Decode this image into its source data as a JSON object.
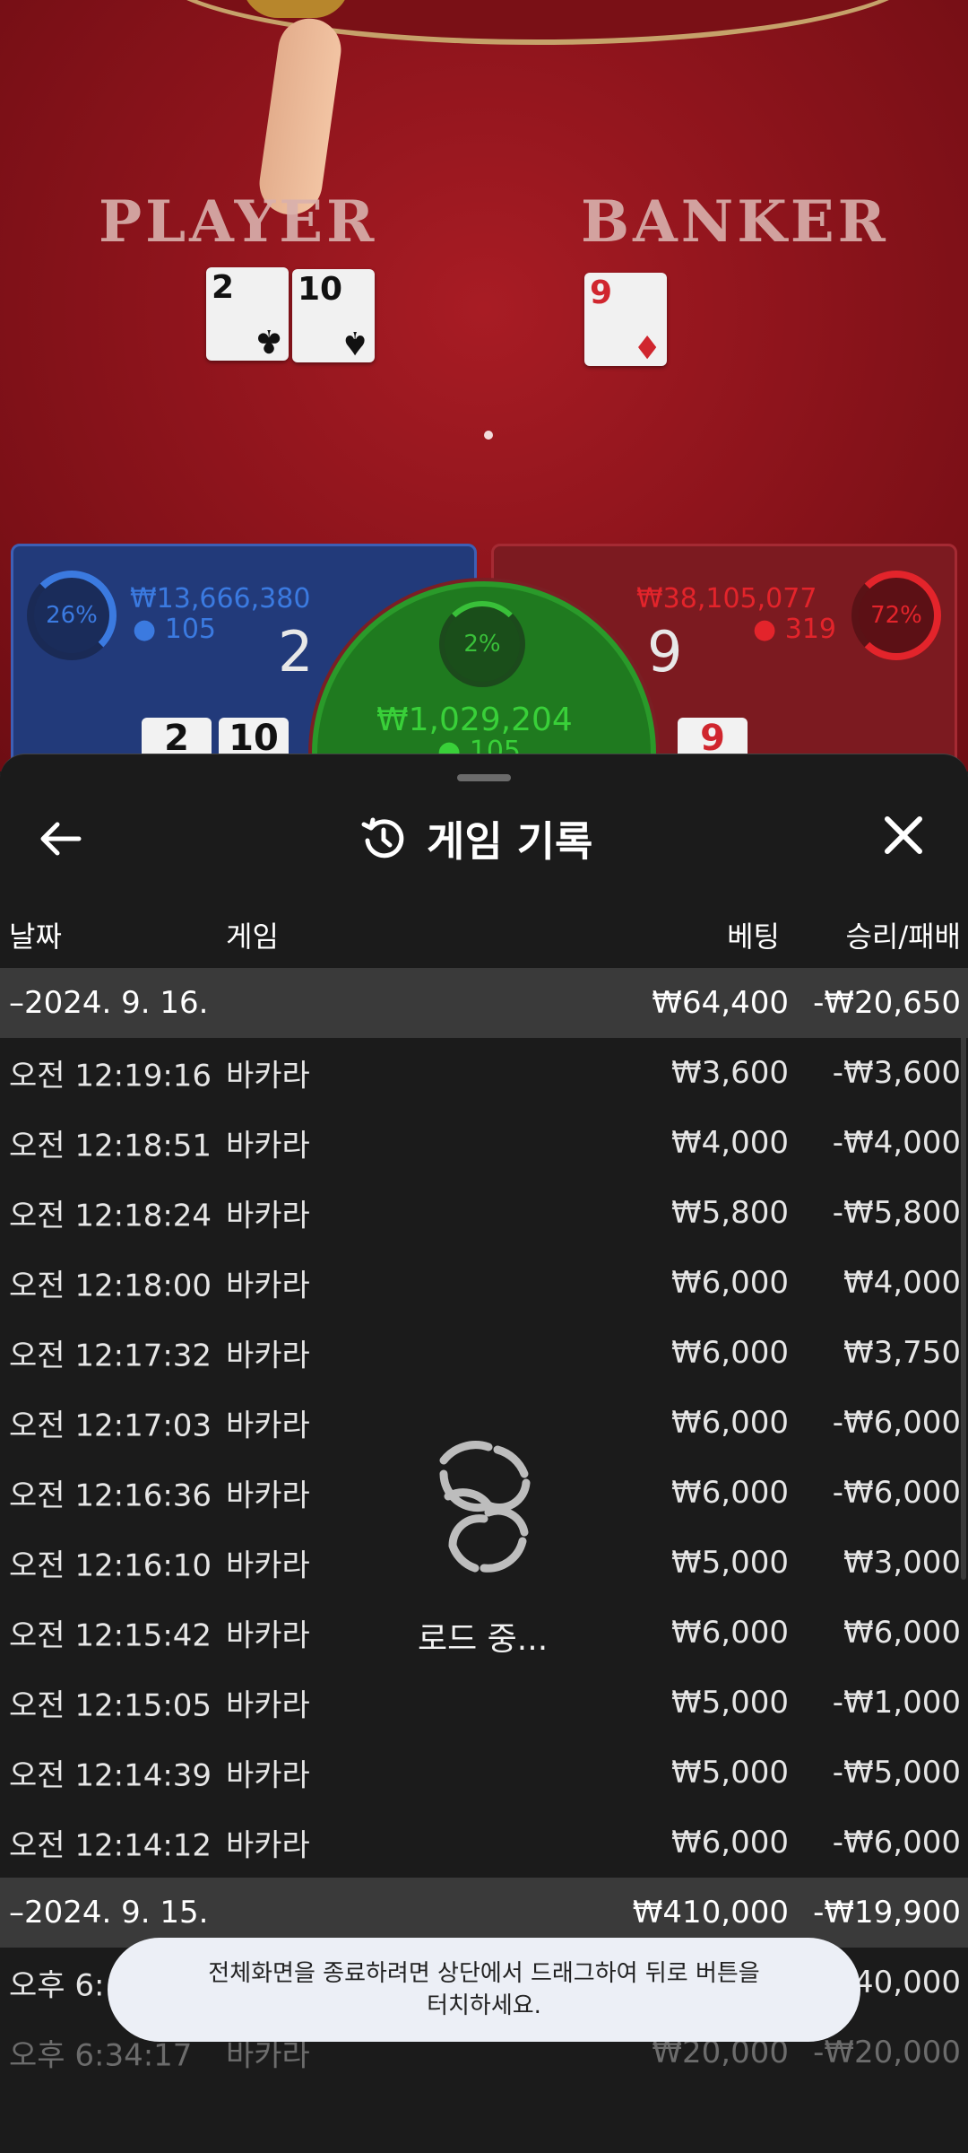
{
  "game_view": {
    "player_label": "PLAYER",
    "banker_label": "BANKER",
    "player_cards": [
      {
        "rank": "2",
        "suit": "♣",
        "color": "black"
      },
      {
        "rank": "10",
        "suit": "♠",
        "color": "black"
      }
    ],
    "banker_cards": [
      {
        "rank": "9",
        "suit": "♦",
        "color": "red"
      }
    ],
    "player_panel": {
      "percent": "26%",
      "amount": "₩13,666,380",
      "bettors": "105",
      "score": "2",
      "cards": [
        "2",
        "10"
      ]
    },
    "banker_panel": {
      "percent": "72%",
      "amount": "₩38,105,077",
      "bettors": "319",
      "score": "9",
      "cards": [
        "9"
      ]
    },
    "tie_panel": {
      "percent": "2%",
      "amount": "₩1,029,204",
      "bettors": "105"
    },
    "colors": {
      "player": "#3b7ae0",
      "banker": "#e3242b",
      "tie": "#39c039"
    }
  },
  "sheet": {
    "title": "게임 기록",
    "back_icon": "arrow-left-icon",
    "history_icon": "history-icon",
    "close_icon": "close-icon",
    "columns": {
      "date": "날짜",
      "game": "게임",
      "bet": "베팅",
      "result": "승리/패배"
    },
    "groups": [
      {
        "date": "–2024. 9. 16.",
        "bet_total": "₩64,400",
        "result_total": "-₩20,650",
        "rows": [
          {
            "time": "오전 12:19:16",
            "game": "바카라",
            "bet": "₩3,600",
            "result": "-₩3,600"
          },
          {
            "time": "오전 12:18:51",
            "game": "바카라",
            "bet": "₩4,000",
            "result": "-₩4,000"
          },
          {
            "time": "오전 12:18:24",
            "game": "바카라",
            "bet": "₩5,800",
            "result": "-₩5,800"
          },
          {
            "time": "오전 12:18:00",
            "game": "바카라",
            "bet": "₩6,000",
            "result": "₩4,000"
          },
          {
            "time": "오전 12:17:32",
            "game": "바카라",
            "bet": "₩6,000",
            "result": "₩3,750"
          },
          {
            "time": "오전 12:17:03",
            "game": "바카라",
            "bet": "₩6,000",
            "result": "-₩6,000"
          },
          {
            "time": "오전 12:16:36",
            "game": "바카라",
            "bet": "₩6,000",
            "result": "-₩6,000"
          },
          {
            "time": "오전 12:16:10",
            "game": "바카라",
            "bet": "₩5,000",
            "result": "₩3,000"
          },
          {
            "time": "오전 12:15:42",
            "game": "바카라",
            "bet": "₩6,000",
            "result": "₩6,000"
          },
          {
            "time": "오전 12:15:05",
            "game": "바카라",
            "bet": "₩5,000",
            "result": "-₩1,000"
          },
          {
            "time": "오전 12:14:39",
            "game": "바카라",
            "bet": "₩5,000",
            "result": "-₩5,000"
          },
          {
            "time": "오전 12:14:12",
            "game": "바카라",
            "bet": "₩6,000",
            "result": "-₩6,000"
          }
        ]
      },
      {
        "date": "–2024. 9. 15.",
        "bet_total": "₩410,000",
        "result_total": "-₩19,900",
        "rows": [
          {
            "time": "오후 6:",
            "game": "",
            "bet": "",
            "result": "40,000"
          },
          {
            "time": "오후 6:34:17",
            "game": "바카라",
            "bet": "₩20,000",
            "result": "-₩20,000"
          }
        ]
      }
    ],
    "loading_text": "로드 중..."
  },
  "toast": {
    "line1": "전체화면을 종료하려면 상단에서 드래그하여 뒤로 버튼을",
    "line2": "터치하세요."
  }
}
